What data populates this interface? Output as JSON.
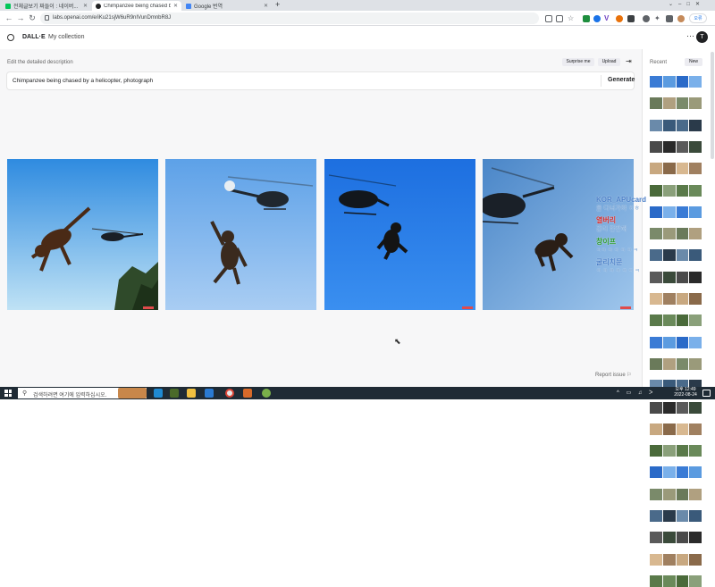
{
  "browser": {
    "tabs": [
      {
        "title": "전체글보기 짜들이 : 네이버...",
        "favicon_color": "#03c75a"
      },
      {
        "title": "Chimpanzee being chased by a...",
        "favicon_color": "#202123",
        "active": true
      },
      {
        "title": "Google 번역",
        "favicon_color": "#4285f4"
      }
    ],
    "new_tab": "+",
    "url": "labs.openai.com/e/iKu21sjW6uR9nIVunDmnbR8J",
    "profile_label": "오류"
  },
  "app": {
    "brand": "DALL·E",
    "nav_collection": "My collection",
    "avatar_initial": "T",
    "more": "⋯",
    "description_label": "Edit the detailed description",
    "surprise_label": "Surprise me",
    "upload_label": "Upload",
    "prompt": "Chimpanzee being chased by a helicopter, photograph",
    "generate_label": "Generate",
    "report_label": "Report issue"
  },
  "sidebar": {
    "recent_label": "Recent",
    "new_label": "New"
  },
  "overlay": {
    "line1": "KOR_APUcard",
    "line2": "을 다녀가야 ㅎㅎ",
    "line3": "열버리",
    "line4": "감리 한잔해",
    "line5": "창이프",
    "line6": "ㅋㅋ ㅋ ㅋ ㅋ ㅋ ㅋ",
    "line7": "굴리치문",
    "line8": "ㅋ ㅋ ㅋ ㅋ ㅋ ㅋ ㅋ"
  },
  "taskbar": {
    "search_placeholder": "검색하려면 여기에 입력하십시오.",
    "time": "오후 12:49",
    "date": "2022-08-24"
  }
}
